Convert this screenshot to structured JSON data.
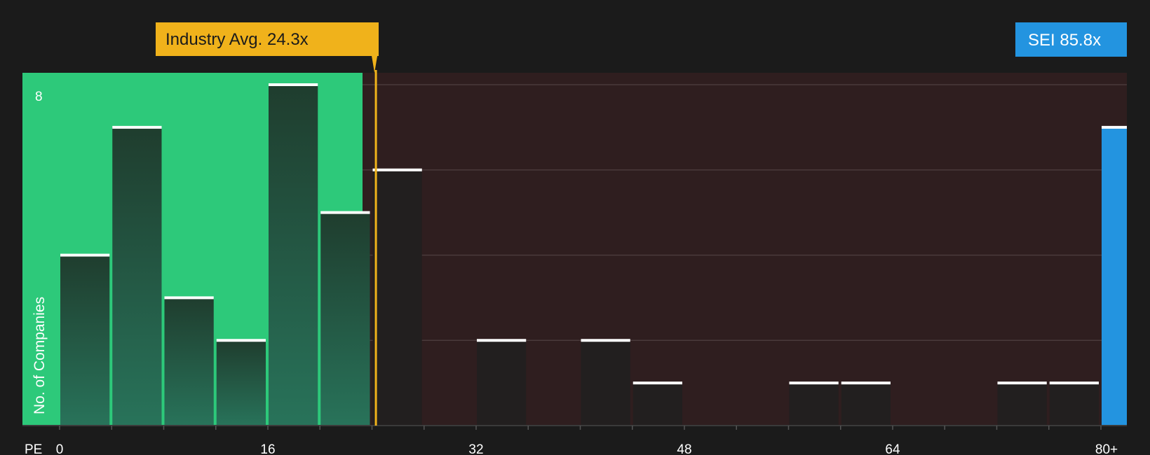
{
  "chart_data": {
    "type": "bar",
    "ylabel": "No. of Companies",
    "xlabel": "PE",
    "y_max_label": "8",
    "ylim": [
      0,
      8
    ],
    "x_tick_labels": [
      {
        "label": "0",
        "value": 0
      },
      {
        "label": "16",
        "value": 16
      },
      {
        "label": "32",
        "value": 32
      },
      {
        "label": "48",
        "value": 48
      },
      {
        "label": "64",
        "value": 64
      },
      {
        "label": "80+",
        "value": 80
      }
    ],
    "bin_width": 4,
    "bars": [
      {
        "bin_start": 0,
        "bin_end": 4,
        "count": 4
      },
      {
        "bin_start": 4,
        "bin_end": 8,
        "count": 7
      },
      {
        "bin_start": 8,
        "bin_end": 12,
        "count": 3
      },
      {
        "bin_start": 12,
        "bin_end": 16,
        "count": 2
      },
      {
        "bin_start": 16,
        "bin_end": 20,
        "count": 8
      },
      {
        "bin_start": 20,
        "bin_end": 24,
        "count": 5
      },
      {
        "bin_start": 24,
        "bin_end": 28,
        "count": 6
      },
      {
        "bin_start": 32,
        "bin_end": 36,
        "count": 2
      },
      {
        "bin_start": 40,
        "bin_end": 44,
        "count": 2
      },
      {
        "bin_start": 44,
        "bin_end": 48,
        "count": 1
      },
      {
        "bin_start": 56,
        "bin_end": 60,
        "count": 1
      },
      {
        "bin_start": 60,
        "bin_end": 64,
        "count": 1
      },
      {
        "bin_start": 72,
        "bin_end": 76,
        "count": 1
      },
      {
        "bin_start": 76,
        "bin_end": 80,
        "count": 1
      }
    ],
    "industry_avg": {
      "label": "Industry Avg. 24.3x",
      "value": 24.3
    },
    "company": {
      "label": "SEI 85.8x",
      "value": 85.8,
      "count": 7
    },
    "colors": {
      "background": "#1b1b1b",
      "good_zone": "#2dc97a",
      "bad_zone": "#2f1e1f",
      "bar_fill_dark": "#203a2d",
      "bar_on_bad": "#221f1f",
      "bar_top": "#ffffff",
      "avg_line": "#f0b21b",
      "company_bar": "#2394e0",
      "grid": "#4a3a3b",
      "text": "#ffffff",
      "avg_label_text": "#1b1b1b"
    }
  }
}
